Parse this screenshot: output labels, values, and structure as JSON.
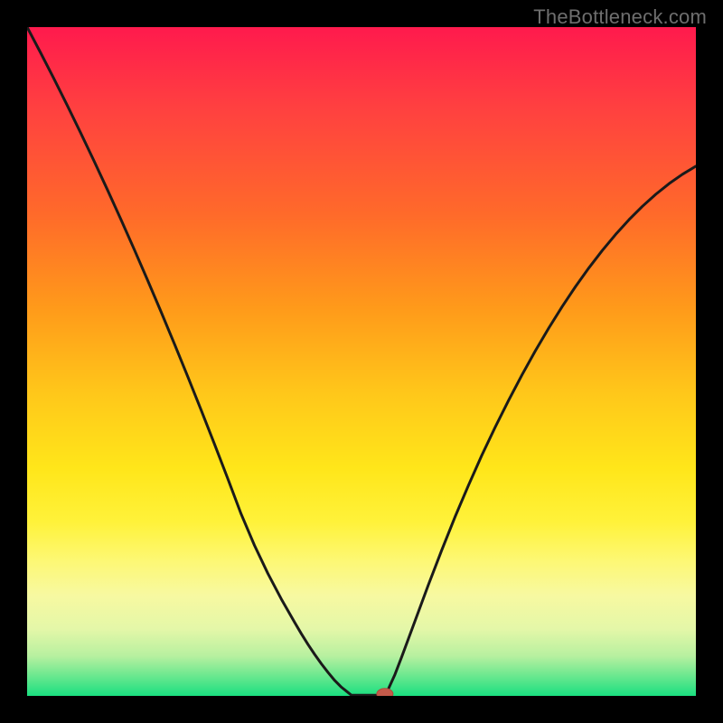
{
  "watermark": "TheBottleneck.com",
  "colors": {
    "frame": "#000000",
    "curve_stroke": "#1a1a1a",
    "marker_fill": "#c45a4a",
    "marker_stroke": "#b04a3a"
  },
  "chart_data": {
    "type": "line",
    "title": "",
    "xlabel": "",
    "ylabel": "",
    "xlim": [
      0,
      100
    ],
    "ylim": [
      0,
      100
    ],
    "series": [
      {
        "name": "left-branch",
        "x": [
          0,
          2,
          4,
          6,
          8,
          10,
          12,
          14,
          16,
          18,
          20,
          22,
          24,
          26,
          28,
          30,
          32,
          34,
          36,
          38,
          40,
          41,
          42,
          43,
          44,
          45,
          46,
          47,
          48,
          48.5
        ],
        "y": [
          100,
          96.2,
          92.3,
          88.3,
          84.2,
          80.0,
          75.7,
          71.3,
          66.8,
          62.2,
          57.5,
          52.7,
          47.8,
          42.8,
          37.7,
          32.5,
          27.2,
          22.5,
          18.3,
          14.5,
          11.0,
          9.3,
          7.7,
          6.2,
          4.8,
          3.5,
          2.3,
          1.3,
          0.5,
          0.1
        ]
      },
      {
        "name": "flat-bottom",
        "x": [
          48.5,
          49,
          50,
          51,
          52,
          53,
          53.5
        ],
        "y": [
          0.1,
          0.1,
          0.1,
          0.1,
          0.1,
          0.1,
          0.1
        ]
      },
      {
        "name": "right-branch",
        "x": [
          53.5,
          54,
          55,
          56,
          57,
          58,
          60,
          62,
          64,
          66,
          68,
          70,
          72,
          74,
          76,
          78,
          80,
          82,
          84,
          86,
          88,
          90,
          92,
          94,
          96,
          98,
          100
        ],
        "y": [
          0.1,
          1.0,
          3.2,
          5.8,
          8.5,
          11.2,
          16.6,
          21.8,
          26.8,
          31.5,
          36.0,
          40.2,
          44.2,
          48.0,
          51.6,
          55.0,
          58.2,
          61.2,
          64.0,
          66.6,
          69.0,
          71.2,
          73.2,
          75.0,
          76.6,
          78.0,
          79.2
        ]
      }
    ],
    "marker": {
      "x": 53.5,
      "y": 0.3
    },
    "gradient_stops": [
      {
        "pos": 0,
        "color": "#ff1a4d"
      },
      {
        "pos": 12,
        "color": "#ff4040"
      },
      {
        "pos": 28,
        "color": "#ff6a2a"
      },
      {
        "pos": 42,
        "color": "#ff9a1a"
      },
      {
        "pos": 55,
        "color": "#ffc81a"
      },
      {
        "pos": 66,
        "color": "#ffe61a"
      },
      {
        "pos": 74,
        "color": "#fff23a"
      },
      {
        "pos": 80,
        "color": "#fdf876"
      },
      {
        "pos": 85,
        "color": "#f7f9a1"
      },
      {
        "pos": 90,
        "color": "#e4f7a8"
      },
      {
        "pos": 94,
        "color": "#b8f0a0"
      },
      {
        "pos": 97,
        "color": "#6be88f"
      },
      {
        "pos": 100,
        "color": "#1adf80"
      }
    ]
  }
}
